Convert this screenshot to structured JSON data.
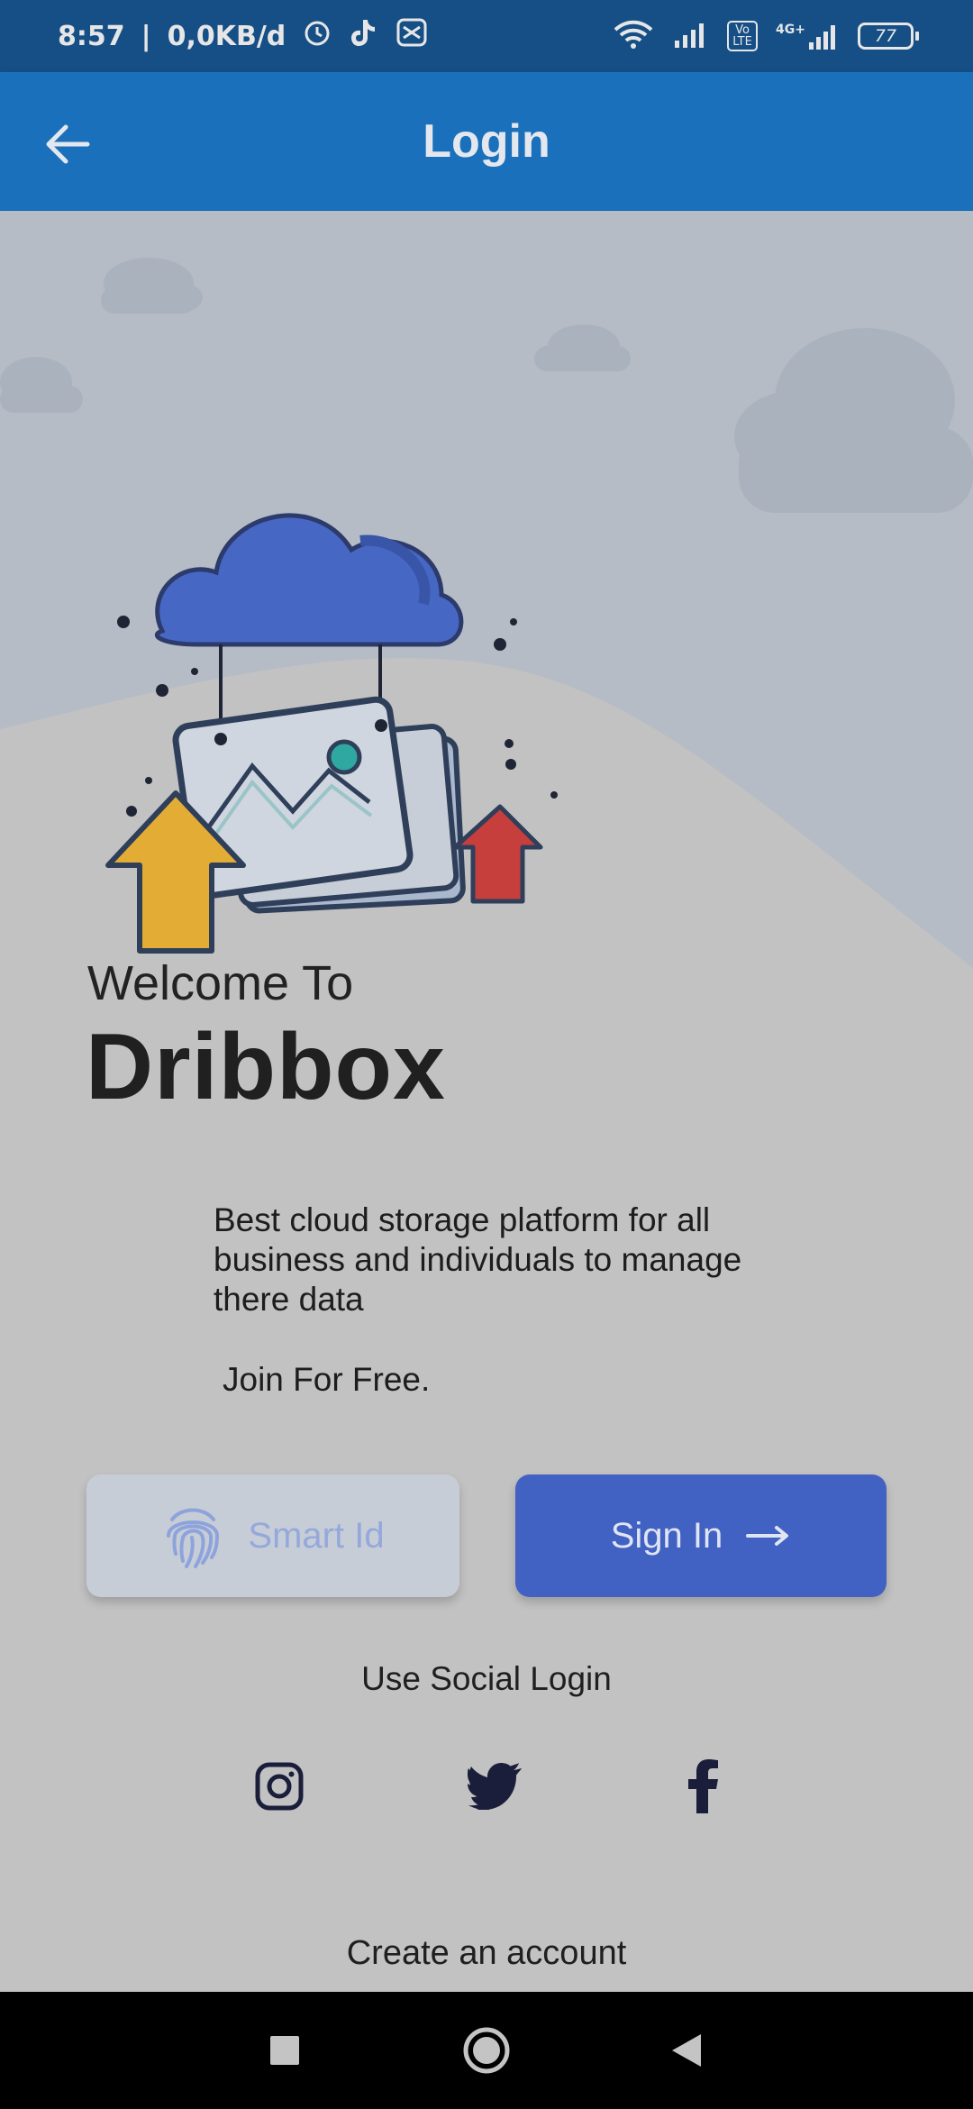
{
  "status": {
    "time": "8:57",
    "data_rate": "0,0KB/d",
    "battery": "77",
    "lte_label": "Vo LTE",
    "network_label": "4G+"
  },
  "app_bar": {
    "title": "Login"
  },
  "hero": {
    "welcome": "Welcome To",
    "brand": "Dribbox",
    "description": "Best cloud storage platform for all business and individuals to manage there data",
    "join": "Join For Free."
  },
  "buttons": {
    "smart_id": "Smart Id",
    "sign_in": "Sign In"
  },
  "social": {
    "label": "Use Social Login",
    "icons": [
      "instagram-icon",
      "twitter-icon",
      "facebook-icon"
    ]
  },
  "footer": {
    "create_account": "Create an account"
  },
  "colors": {
    "app_bar": "#1b70bb",
    "status_bar": "#154f86",
    "primary_button": "#4161c3",
    "secondary_button": "#c7cdd6",
    "background": "#c2c2c2"
  }
}
